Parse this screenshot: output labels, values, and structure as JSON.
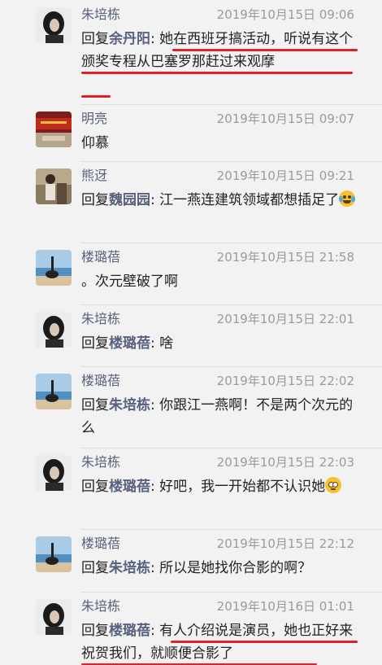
{
  "reply_word": "回复",
  "comments": [
    {
      "name": "朱培栋",
      "time": "2019年10月15日 09:06",
      "reply_to": "余丹阳",
      "text": "她在西班牙搞活动，听说有这个颁奖专程从巴塞罗那赶过来观摩",
      "avatar": "dark-hair-avatar"
    },
    {
      "name": "明亮",
      "time": "2019年10月15日 09:07",
      "text": "仰慕",
      "avatar": "red-banner-avatar"
    },
    {
      "name": "熊迓",
      "time": "2019年10月15日 09:21",
      "reply_to": "魏园园",
      "text": "江一燕连建筑领域都想插足了",
      "emoji": "laugh-cry",
      "avatar": "person-photo-avatar"
    },
    {
      "name": "楼璐蓓",
      "time": "2019年10月15日 21:58",
      "text": "。次元壁破了啊",
      "avatar": "beach-yoga-avatar"
    },
    {
      "name": "朱培栋",
      "time": "2019年10月15日 22:01",
      "reply_to": "楼璐蓓",
      "text": "啥",
      "avatar": "dark-hair-avatar"
    },
    {
      "name": "楼璐蓓",
      "time": "2019年10月15日 22:02",
      "reply_to": "朱培栋",
      "text": "你跟江一燕啊！不是两个次元的么",
      "avatar": "beach-yoga-avatar"
    },
    {
      "name": "朱培栋",
      "time": "2019年10月15日 22:03",
      "reply_to": "楼璐蓓",
      "text": "好吧，我一开始都不认识她",
      "emoji": "flushed",
      "avatar": "dark-hair-avatar"
    },
    {
      "name": "楼璐蓓",
      "time": "2019年10月15日 22:12",
      "reply_to": "朱培栋",
      "text": "所以是她找你合影的啊？",
      "avatar": "beach-yoga-avatar"
    },
    {
      "name": "朱培栋",
      "time": "2019年10月16日 01:01",
      "reply_to": "楼璐蓓",
      "text": "有人介绍说是演员，她也正好来祝贺我们，就顺便合影了",
      "avatar": "dark-hair-avatar"
    }
  ]
}
